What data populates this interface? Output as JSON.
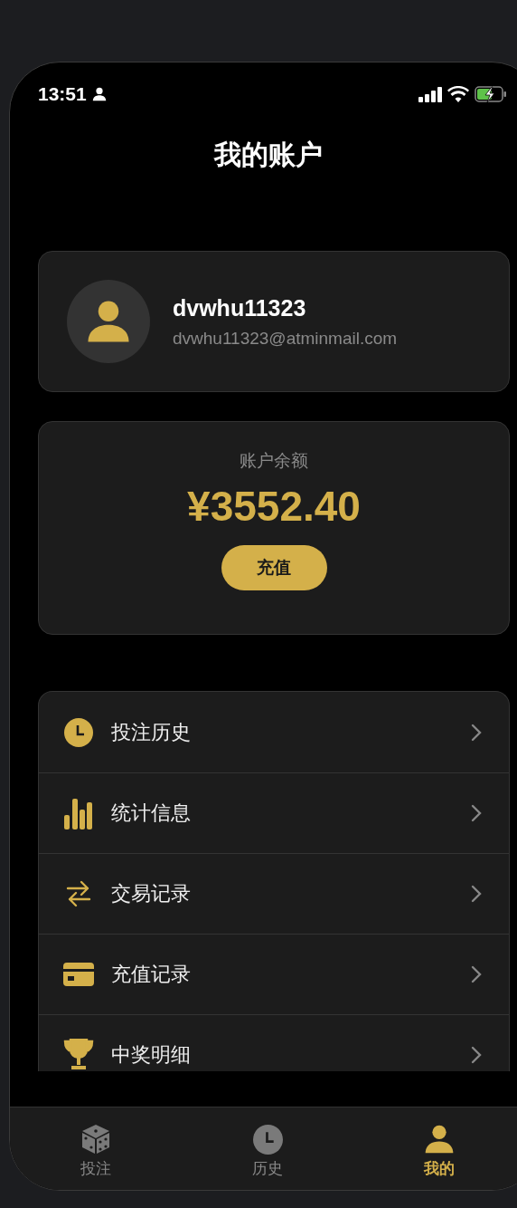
{
  "status_bar": {
    "time": "13:51"
  },
  "title": "我的账户",
  "profile": {
    "username": "dvwhu11323",
    "email": "dvwhu11323@atminmail.com"
  },
  "balance": {
    "label": "账户余额",
    "amount": "¥3552.40",
    "button": "充值"
  },
  "menu": [
    {
      "kind": "clock",
      "label": "投注历史"
    },
    {
      "kind": "chart",
      "label": "统计信息"
    },
    {
      "kind": "transfer",
      "label": "交易记录"
    },
    {
      "kind": "card",
      "label": "充值记录"
    },
    {
      "kind": "trophy",
      "label": "中奖明细"
    }
  ],
  "tabs": [
    {
      "kind": "dice",
      "label": "投注",
      "selected": false
    },
    {
      "kind": "clock",
      "label": "历史",
      "selected": false
    },
    {
      "kind": "person",
      "label": "我的",
      "selected": true
    }
  ]
}
